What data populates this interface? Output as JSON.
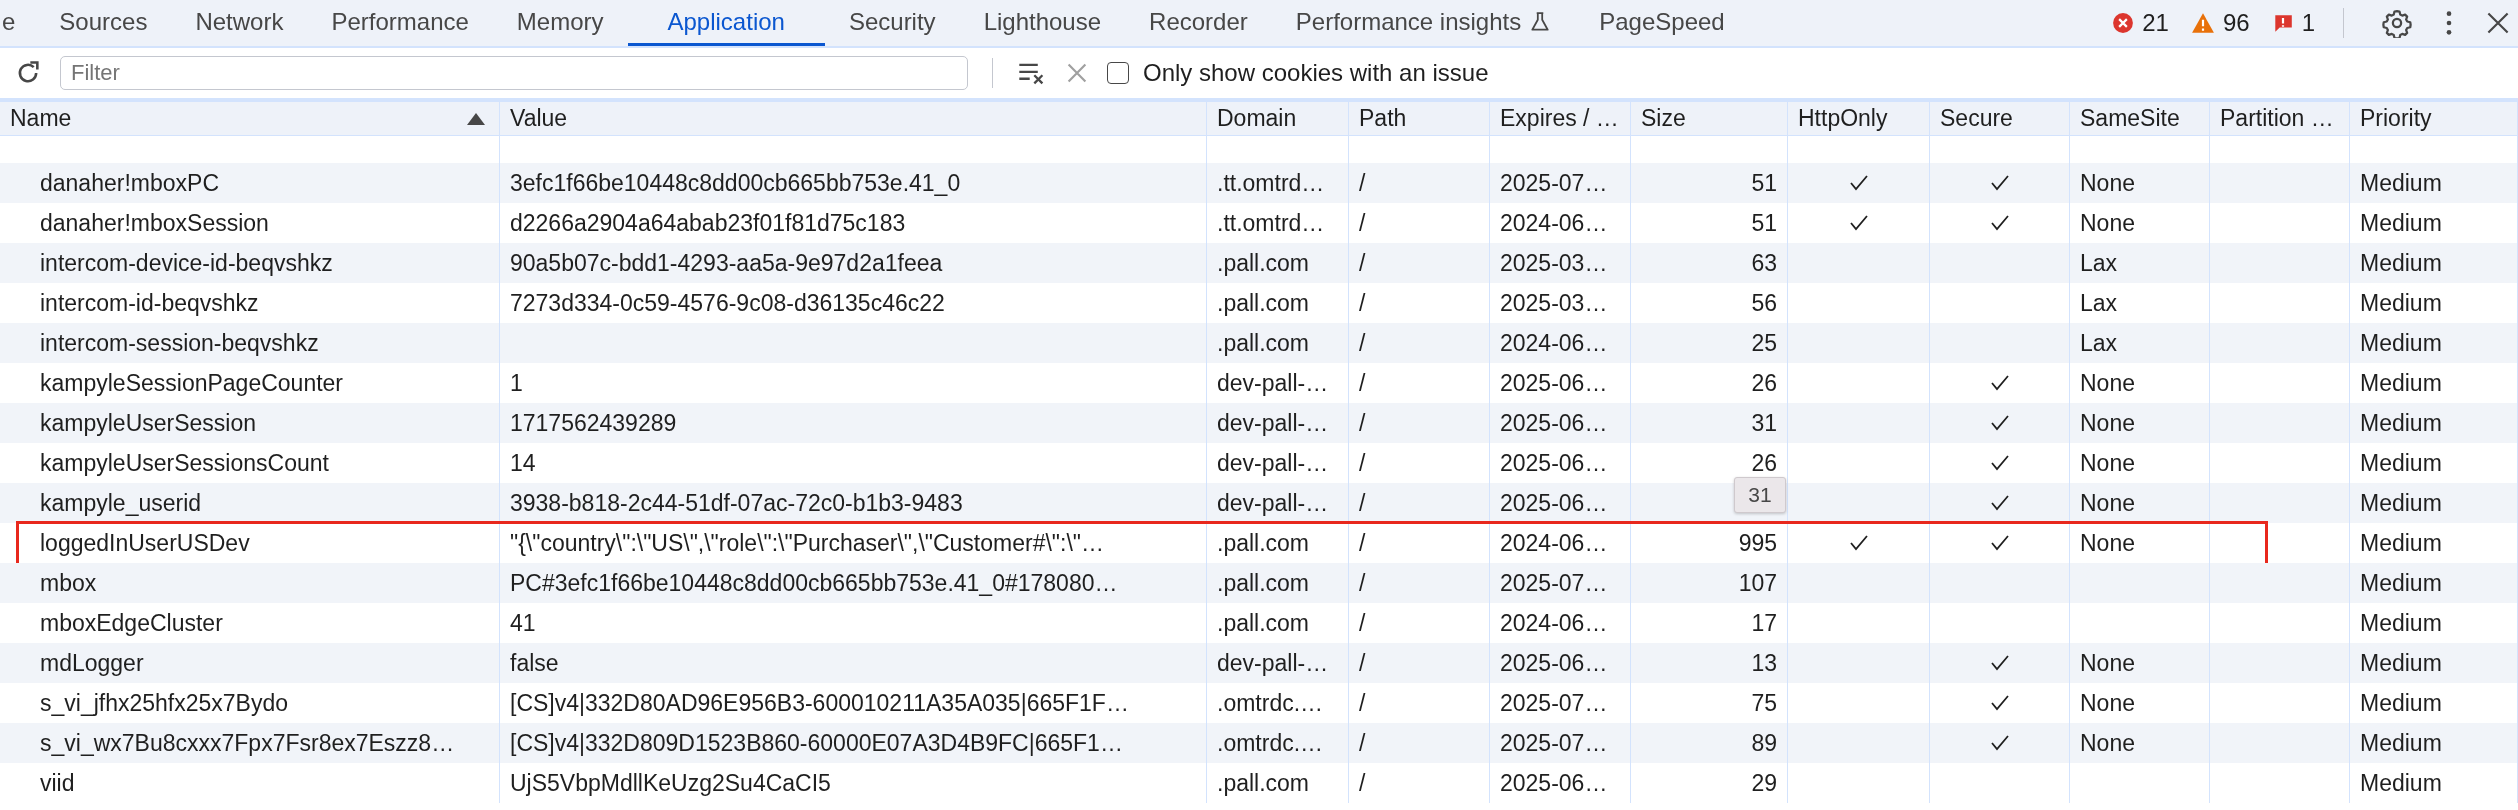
{
  "tabs": [
    {
      "label": "e",
      "kind": "plain",
      "selected": false
    },
    {
      "label": "Sources",
      "kind": "plain",
      "selected": false
    },
    {
      "label": "Network",
      "kind": "plain",
      "selected": false
    },
    {
      "label": "Performance",
      "kind": "plain",
      "selected": false
    },
    {
      "label": "Memory",
      "kind": "plain",
      "selected": false
    },
    {
      "label": "Application",
      "kind": "plain",
      "selected": true
    },
    {
      "label": "Security",
      "kind": "plain",
      "selected": false
    },
    {
      "label": "Lighthouse",
      "kind": "plain",
      "selected": false
    },
    {
      "label": "Recorder",
      "kind": "plain",
      "selected": false
    },
    {
      "label": "Performance insights",
      "kind": "experimental",
      "selected": false
    },
    {
      "label": "PageSpeed",
      "kind": "plain",
      "selected": false
    }
  ],
  "counters": [
    {
      "kind": "error",
      "count": "21"
    },
    {
      "kind": "warning",
      "count": "96"
    },
    {
      "kind": "issue",
      "count": "1"
    }
  ],
  "toolbar": {
    "filter": {
      "placeholder": "Filter"
    },
    "checkbox": {
      "label": "Only show cookies with an issue",
      "checked": false
    }
  },
  "table": {
    "columns": [
      {
        "label": "Name",
        "sorted": true
      },
      {
        "label": "Value",
        "sorted": false
      },
      {
        "label": "Domain",
        "sorted": false
      },
      {
        "label": "Path",
        "sorted": false
      },
      {
        "label": "Expires / …",
        "sorted": false
      },
      {
        "label": "Size",
        "sorted": false
      },
      {
        "label": "HttpOnly",
        "sorted": false
      },
      {
        "label": "Secure",
        "sorted": false
      },
      {
        "label": "SameSite",
        "sorted": false
      },
      {
        "label": "Partition …",
        "sorted": false
      },
      {
        "label": "Priority",
        "sorted": false
      }
    ],
    "rows": [
      {
        "name": "danaher!mboxPC",
        "value": "3efc1f66be10448c8dd00cb665bb753e.41_0",
        "domain": ".tt.omtrd…",
        "path": "/",
        "expires": "2025-07…",
        "size": "51",
        "http_only": true,
        "secure": true,
        "same_site": "None",
        "priority": "Medium",
        "outlined": false
      },
      {
        "name": "danaher!mboxSession",
        "value": "d2266a2904a64abab23f01f81d75c183",
        "domain": ".tt.omtrd…",
        "path": "/",
        "expires": "2024-06…",
        "size": "51",
        "http_only": true,
        "secure": true,
        "same_site": "None",
        "priority": "Medium",
        "outlined": false
      },
      {
        "name": "intercom-device-id-beqvshkz",
        "value": "90a5b07c-bdd1-4293-aa5a-9e97d2a1feea",
        "domain": ".pall.com",
        "path": "/",
        "expires": "2025-03…",
        "size": "63",
        "http_only": false,
        "secure": false,
        "same_site": "Lax",
        "priority": "Medium",
        "outlined": false
      },
      {
        "name": "intercom-id-beqvshkz",
        "value": "7273d334-0c59-4576-9c08-d36135c46c22",
        "domain": ".pall.com",
        "path": "/",
        "expires": "2025-03…",
        "size": "56",
        "http_only": false,
        "secure": false,
        "same_site": "Lax",
        "priority": "Medium",
        "outlined": false
      },
      {
        "name": "intercom-session-beqvshkz",
        "domain": ".pall.com",
        "path": "/",
        "expires": "2024-06…",
        "size": "25",
        "http_only": false,
        "secure": false,
        "same_site": "Lax",
        "priority": "Medium",
        "outlined": false
      },
      {
        "name": "kampyleSessionPageCounter",
        "value": "1",
        "domain": "dev-pall-…",
        "path": "/",
        "expires": "2025-06…",
        "size": "26",
        "http_only": false,
        "secure": true,
        "same_site": "None",
        "priority": "Medium",
        "outlined": false
      },
      {
        "name": "kampyleUserSession",
        "value": "1717562439289",
        "domain": "dev-pall-…",
        "path": "/",
        "expires": "2025-06…",
        "size": "31",
        "http_only": false,
        "secure": true,
        "same_site": "None",
        "priority": "Medium",
        "outlined": false
      },
      {
        "name": "kampyleUserSessionsCount",
        "value": "14",
        "domain": "dev-pall-…",
        "path": "/",
        "expires": "2025-06…",
        "size": "26",
        "http_only": false,
        "secure": true,
        "same_site": "None",
        "priority": "Medium",
        "outlined": false
      },
      {
        "name": "kampyle_userid",
        "value": "3938-b818-2c44-51df-07ac-72c0-b1b3-9483",
        "domain": "dev-pall-…",
        "path": "/",
        "expires": "2025-06…",
        "http_only": false,
        "secure": true,
        "same_site": "None",
        "priority": "Medium",
        "outlined": false,
        "tooltip": "31"
      },
      {
        "name": "loggedInUserUSDev",
        "value": "\"{\\\"country\\\":\\\"US\\\",\\\"role\\\":\\\"Purchaser\\\",\\\"Customer#\\\":\\\"…",
        "domain": ".pall.com",
        "path": "/",
        "expires": "2024-06…",
        "size": "995",
        "http_only": true,
        "secure": true,
        "same_site": "None",
        "priority": "Medium",
        "outlined": true
      },
      {
        "name": "mbox",
        "value": "PC#3efc1f66be10448c8dd00cb665bb753e.41_0#178080…",
        "domain": ".pall.com",
        "path": "/",
        "expires": "2025-07…",
        "size": "107",
        "http_only": false,
        "secure": false,
        "priority": "Medium",
        "outlined": false
      },
      {
        "name": "mboxEdgeCluster",
        "value": "41",
        "domain": ".pall.com",
        "path": "/",
        "expires": "2024-06…",
        "size": "17",
        "http_only": false,
        "secure": false,
        "priority": "Medium",
        "outlined": false
      },
      {
        "name": "mdLogger",
        "value": "false",
        "domain": "dev-pall-…",
        "path": "/",
        "expires": "2025-06…",
        "size": "13",
        "http_only": false,
        "secure": true,
        "same_site": "None",
        "priority": "Medium",
        "outlined": false
      },
      {
        "name": "s_vi_jfhx25hfx25x7Bydo",
        "value": "[CS]v4|332D80AD96E956B3-600010211A35A035|665F1F…",
        "domain": ".omtrdc.…",
        "path": "/",
        "expires": "2025-07…",
        "size": "75",
        "http_only": false,
        "secure": true,
        "same_site": "None",
        "priority": "Medium",
        "outlined": false
      },
      {
        "name": "s_vi_wx7Bu8cxxx7Fpx7Fsr8ex7Eszz8…",
        "value": "[CS]v4|332D809D1523B860-60000E07A3D4B9FC|665F1…",
        "domain": ".omtrdc.…",
        "path": "/",
        "expires": "2025-07…",
        "size": "89",
        "http_only": false,
        "secure": true,
        "same_site": "None",
        "priority": "Medium",
        "outlined": false
      },
      {
        "name": "viid",
        "value": "UjS5VbpMdllKeUzg2Su4CaCI5",
        "domain": ".pall.com",
        "path": "/",
        "expires": "2025-06…",
        "size": "29",
        "http_only": false,
        "secure": false,
        "priority": "Medium",
        "outlined": false
      }
    ]
  }
}
